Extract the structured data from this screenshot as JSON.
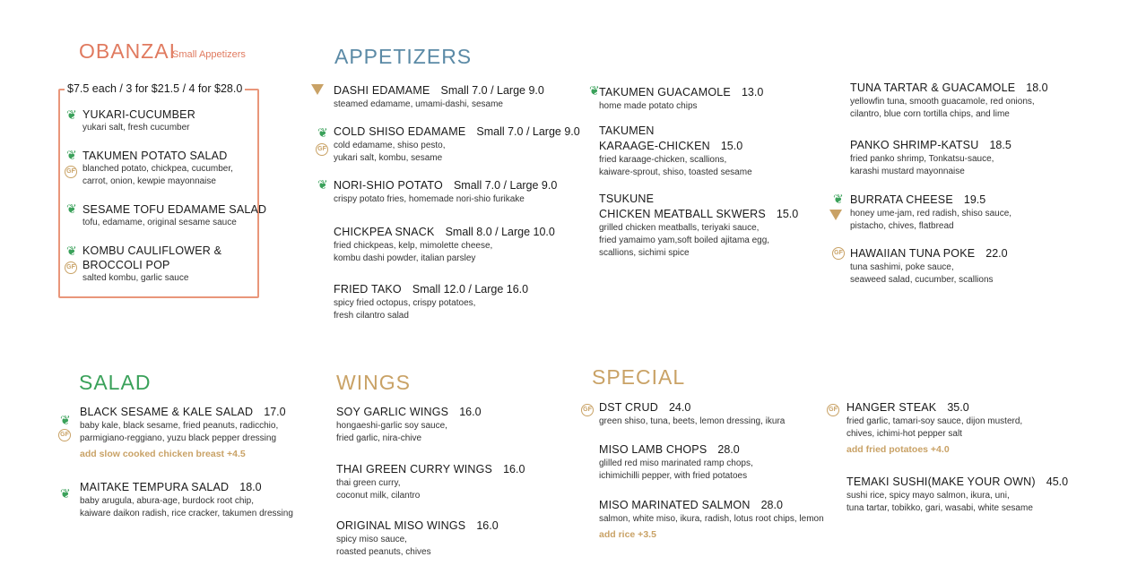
{
  "obanzai": {
    "title": "OBANZAI",
    "subtitle": "Small Appetizers",
    "pricing": "$7.5 each / 3 for $21.5 / 4 for $28.0",
    "items": [
      {
        "name": "YUKARI-CUCUMBER",
        "desc": [
          "yukari salt, fresh cucumber"
        ]
      },
      {
        "name": "TAKUMEN POTATO SALAD",
        "desc": [
          "blanched potato, chickpea, cucumber,",
          "carrot, onion, kewpie mayonnaise"
        ]
      },
      {
        "name": "SESAME TOFU EDAMAME SALAD",
        "desc": [
          "tofu, edamame, original sesame sauce"
        ]
      },
      {
        "name": [
          "KOMBU CAULIFLOWER &",
          "BROCCOLI POP"
        ],
        "desc": [
          "salted kombu, garlic sauce"
        ]
      }
    ]
  },
  "appetizers": {
    "title": "APPETIZERS",
    "col1": [
      {
        "name": "DASHI EDAMAME",
        "price": "Small 7.0 / Large 9.0",
        "desc": [
          "steamed edamame, umami-dashi, sesame"
        ]
      },
      {
        "name": "COLD SHISO EDAMAME",
        "price": "Small 7.0 / Large 9.0",
        "desc": [
          "cold edamame, shiso pesto,",
          "yukari salt, kombu, sesame"
        ]
      },
      {
        "name": "NORI-SHIO POTATO",
        "price": "Small 7.0 / Large 9.0",
        "desc": [
          "crispy potato fries, homemade nori-shio furikake"
        ]
      },
      {
        "name": "CHICKPEA SNACK",
        "price": "Small 8.0 / Large 10.0",
        "desc": [
          "fried chickpeas, kelp, mimolette cheese,",
          "kombu dashi powder, italian parsley"
        ]
      },
      {
        "name": "FRIED TAKO",
        "price": "Small 12.0 / Large 16.0",
        "desc": [
          "spicy fried octopus, crispy potatoes,",
          "fresh cilantro salad"
        ]
      }
    ],
    "col2": [
      {
        "name": "TAKUMEN GUACAMOLE",
        "price": "13.0",
        "desc": [
          "home made potato chips"
        ]
      },
      {
        "name_lines": [
          "TAKUMEN",
          "KARAAGE-CHICKEN"
        ],
        "price": "15.0",
        "desc": [
          "fried karaage-chicken, scallions,",
          "kaiware-sprout, shiso, toasted sesame"
        ]
      },
      {
        "name_lines": [
          "TSUKUNE",
          "CHICKEN MEATBALL SKWERS"
        ],
        "price": "15.0",
        "desc": [
          "grilled chicken meatballs, teriyaki sauce,",
          "fried yamaimo yam,soft boiled ajitama egg,",
          "scallions, sichimi spice"
        ]
      }
    ],
    "col3": [
      {
        "name": "TUNA TARTAR & GUACAMOLE",
        "price": "18.0",
        "desc": [
          "yellowfin tuna, smooth guacamole, red onions,",
          "cilantro, blue corn tortilla chips, and lime"
        ]
      },
      {
        "name": "PANKO SHRIMP-KATSU",
        "price": "18.5",
        "desc": [
          "fried panko shrimp, Tonkatsu-sauce,",
          "karashi mustard mayonnaise"
        ]
      },
      {
        "name": "BURRATA CHEESE",
        "price": "19.5",
        "desc": [
          "honey ume-jam, red radish, shiso sauce,",
          "pistacho, chives, flatbread"
        ]
      },
      {
        "name": "HAWAIIAN TUNA POKE",
        "price": "22.0",
        "desc": [
          "tuna sashimi, poke sauce,",
          "seaweed salad, cucumber, scallions"
        ]
      }
    ]
  },
  "salad": {
    "title": "SALAD",
    "items": [
      {
        "name": "BLACK SESAME & KALE SALAD",
        "price": "17.0",
        "desc": [
          "baby kale, black sesame, fried peanuts, radicchio,",
          "parmigiano-reggiano, yuzu black pepper dressing"
        ],
        "addon": "add slow cooked chicken breast +4.5"
      },
      {
        "name": "MAITAKE TEMPURA SALAD",
        "price": "18.0",
        "desc": [
          "baby arugula, abura-age, burdock root chip,",
          "kaiware daikon radish, rice cracker, takumen dressing"
        ]
      }
    ]
  },
  "wings": {
    "title": "WINGS",
    "items": [
      {
        "name": "SOY GARLIC WINGS",
        "price": "16.0",
        "desc": [
          "hongaeshi-garlic soy sauce,",
          "fried garlic, nira-chive"
        ]
      },
      {
        "name": "THAI GREEN CURRY WINGS",
        "price": "16.0",
        "desc": [
          "thai green curry,",
          "coconut milk, cilantro"
        ]
      },
      {
        "name": "ORIGINAL MISO WINGS",
        "price": "16.0",
        "desc": [
          "spicy miso sauce,",
          "roasted peanuts, chives"
        ]
      }
    ]
  },
  "special": {
    "title": "SPECIAL",
    "col1": [
      {
        "name": "DST CRUD",
        "price": "24.0",
        "desc": [
          "green shiso, tuna, beets, lemon dressing, ikura"
        ]
      },
      {
        "name": "MISO LAMB CHOPS",
        "price": "28.0",
        "desc": [
          "glilled red miso marinated ramp chops,",
          "ichimichilli pepper, with fried potatoes"
        ]
      },
      {
        "name": "MISO MARINATED SALMON",
        "price": "28.0",
        "desc": [
          "salmon, white miso, ikura, radish, lotus root chips, lemon"
        ],
        "addon": "add rice +3.5"
      }
    ],
    "col2": [
      {
        "name": "HANGER STEAK",
        "price": "35.0",
        "desc": [
          "fried garlic, tamari-soy sauce, dijon musterd,",
          "chives, ichimi-hot pepper salt"
        ],
        "addon": "add fried potatoes +4.0"
      },
      {
        "name": "TEMAKI SUSHI(MAKE YOUR OWN)",
        "price": "45.0",
        "desc": [
          "sushi rice, spicy mayo salmon, ikura, uni,",
          "tuna tartar, tobikko, gari, wasabi, white sesame"
        ]
      }
    ]
  },
  "icons": {
    "gf_label": "GF",
    "leaf": "leaf-icon",
    "gluten_free": "gf-icon",
    "vegan": "vegan-triangle-icon"
  },
  "colors": {
    "obanzai": "#e07a5f",
    "appetizers": "#5b8aa6",
    "salad": "#3aa15a",
    "gold": "#c9a266"
  }
}
